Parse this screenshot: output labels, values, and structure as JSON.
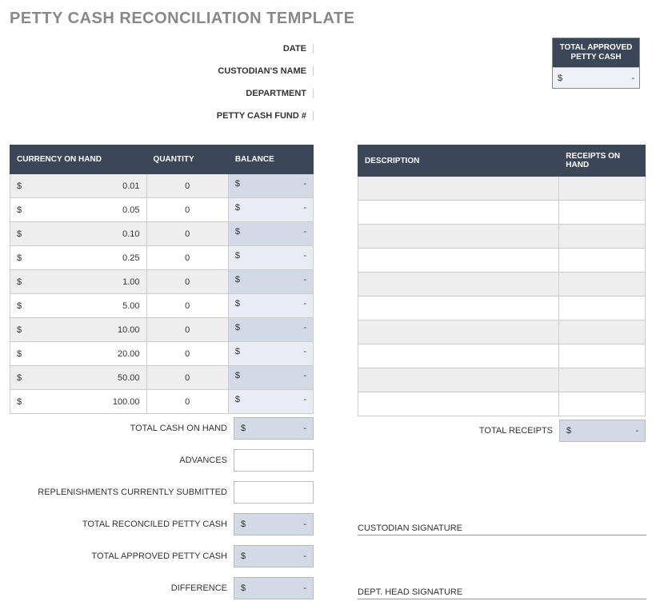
{
  "title": "PETTY CASH RECONCILIATION TEMPLATE",
  "meta": {
    "date": "DATE",
    "custodian": "CUSTODIAN'S NAME",
    "department": "DEPARTMENT",
    "fund": "PETTY CASH FUND #"
  },
  "approved_box": {
    "header": "TOTAL APPROVED PETTY CASH",
    "symbol": "$",
    "value": "-"
  },
  "currency_table": {
    "headers": {
      "currency": "CURRENCY ON HAND",
      "quantity": "QUANTITY",
      "balance": "BALANCE"
    },
    "symbol": "$",
    "rows": [
      {
        "denom": "0.01",
        "qty": "0",
        "bal": "-"
      },
      {
        "denom": "0.05",
        "qty": "0",
        "bal": "-"
      },
      {
        "denom": "0.10",
        "qty": "0",
        "bal": "-"
      },
      {
        "denom": "0.25",
        "qty": "0",
        "bal": "-"
      },
      {
        "denom": "1.00",
        "qty": "0",
        "bal": "-"
      },
      {
        "denom": "5.00",
        "qty": "0",
        "bal": "-"
      },
      {
        "denom": "10.00",
        "qty": "0",
        "bal": "-"
      },
      {
        "denom": "20.00",
        "qty": "0",
        "bal": "-"
      },
      {
        "denom": "50.00",
        "qty": "0",
        "bal": "-"
      },
      {
        "denom": "100.00",
        "qty": "0",
        "bal": "-"
      }
    ]
  },
  "receipts_table": {
    "headers": {
      "description": "DESCRIPTION",
      "receipts": "RECEIPTS ON HAND"
    },
    "rows": [
      {},
      {},
      {},
      {},
      {},
      {},
      {},
      {},
      {},
      {}
    ]
  },
  "totals": {
    "cash_on_hand": {
      "label": "TOTAL CASH ON HAND",
      "symbol": "$",
      "value": "-"
    },
    "advances": {
      "label": "ADVANCES",
      "value": ""
    },
    "replenishments": {
      "label": "REPLENISHMENTS CURRENTLY SUBMITTED",
      "value": ""
    },
    "reconciled": {
      "label": "TOTAL RECONCILED PETTY CASH",
      "symbol": "$",
      "value": "-"
    },
    "approved": {
      "label": "TOTAL APPROVED PETTY CASH",
      "symbol": "$",
      "value": "-"
    },
    "difference": {
      "label": "DIFFERENCE",
      "symbol": "$",
      "value": "-"
    },
    "receipts": {
      "label": "TOTAL RECEIPTS",
      "symbol": "$",
      "value": "-"
    }
  },
  "signatures": {
    "custodian": "CUSTODIAN SIGNATURE",
    "dept_head": "DEPT. HEAD SIGNATURE"
  }
}
